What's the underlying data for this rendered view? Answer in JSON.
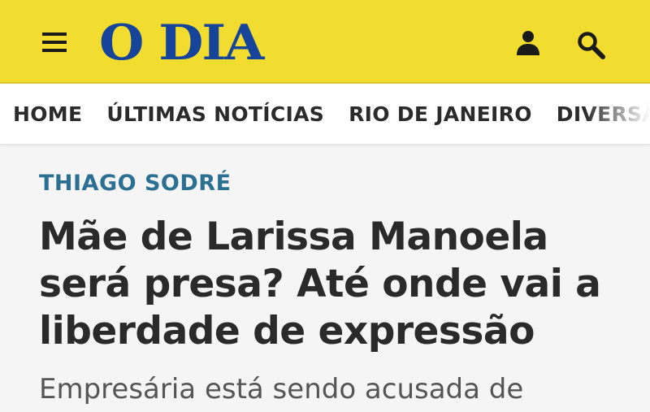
{
  "header": {
    "logo_text": "O DIA",
    "brand_color": "#f2dc2f",
    "logo_color": "#17449b",
    "menu_icon": "menu-icon",
    "account_icon": "user-icon",
    "search_icon": "search-icon"
  },
  "nav": {
    "items": [
      {
        "label": "HOME"
      },
      {
        "label": "ÚLTIMAS NOTÍCIAS"
      },
      {
        "label": "RIO DE JANEIRO"
      },
      {
        "label": "DIVERSÃO"
      }
    ]
  },
  "article": {
    "author": "THIAGO SODRÉ",
    "author_color": "#2b6f93",
    "headline": "Mãe de Larissa Manoela será presa? Até onde vai a liberdade de expressão",
    "summary": "Empresária está sendo acusada de"
  }
}
